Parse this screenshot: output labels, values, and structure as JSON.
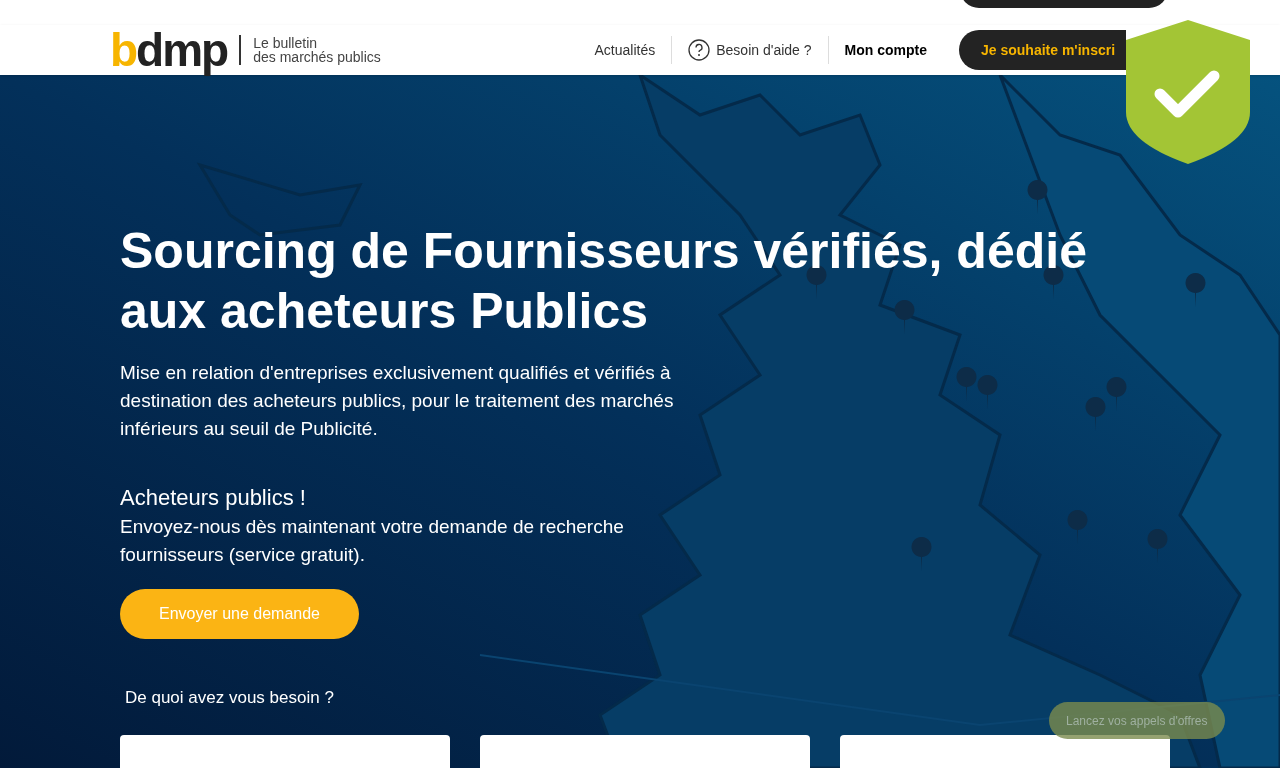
{
  "header": {
    "logo": {
      "parts": [
        {
          "text": "b",
          "color": "#f7b500"
        },
        {
          "text": "dmp",
          "color": "#222222"
        }
      ],
      "tagline": [
        "Le bulletin",
        "des marchés publics"
      ]
    },
    "nav": [
      {
        "label": "Actualités",
        "kind": "link"
      },
      {
        "label": "Besoin d'aide ?",
        "kind": "help"
      },
      {
        "label": "Mon compte",
        "kind": "account"
      }
    ],
    "cta": "Je souhaite m'inscri"
  },
  "hero": {
    "title": "Sourcing de Fournisseurs vérifiés, dédié aux acheteurs Publics",
    "description": "Mise en relation d'entreprises exclusivement qualifiés et vérifiés à destination des acheteurs publics, pour le traitement des marchés inférieurs au seuil de Publicité.",
    "subtitle": "Acheteurs publics !",
    "subtext": "Envoyez-nous dès maintenant votre demande de recherche fournisseurs (service gratuit).",
    "button": "Envoyer une demande",
    "question": "De quoi avez vous besoin ?",
    "fields": [
      {
        "kind": "field"
      },
      {
        "kind": "field"
      },
      {
        "kind": "field"
      }
    ],
    "floating_button": "Lancez vos appels d'offres"
  }
}
